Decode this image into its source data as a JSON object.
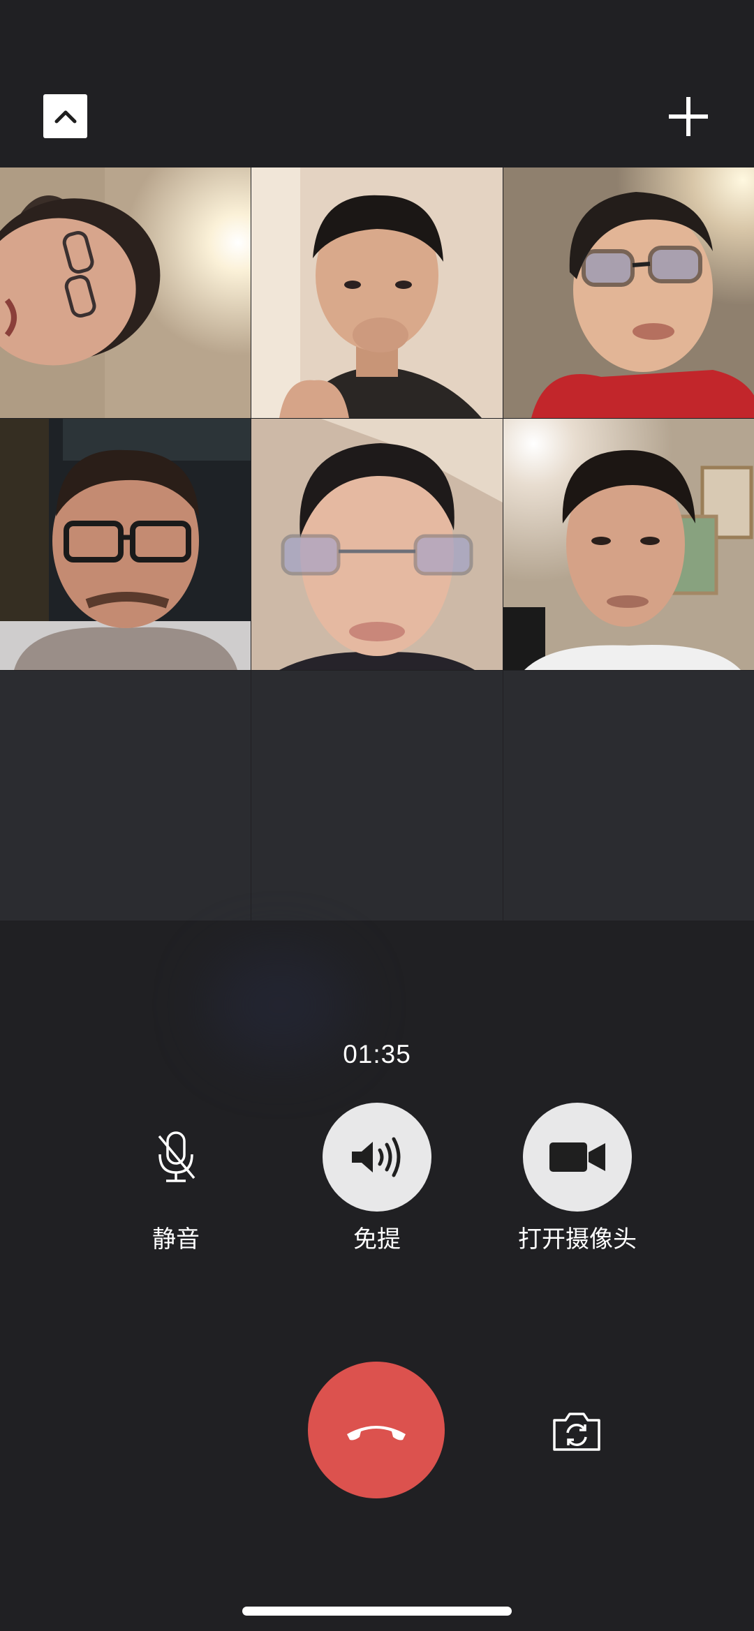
{
  "call": {
    "duration": "01:35"
  },
  "participants": [
    {
      "id": "participant-1"
    },
    {
      "id": "participant-2"
    },
    {
      "id": "participant-3"
    },
    {
      "id": "participant-4"
    },
    {
      "id": "participant-5"
    },
    {
      "id": "participant-6"
    }
  ],
  "controls": {
    "mute_label": "静音",
    "speaker_label": "免提",
    "camera_label": "打开摄像头"
  },
  "icons": {
    "collapse": "chevron-up-icon",
    "add": "plus-icon",
    "mute": "microphone-icon",
    "speaker": "speaker-icon",
    "camera": "video-camera-icon",
    "hangup": "phone-hangup-icon",
    "switch_camera": "camera-switch-icon"
  },
  "colors": {
    "background": "#202023",
    "hangup": "#dc524e",
    "control_bg": "#e8e8e9"
  }
}
